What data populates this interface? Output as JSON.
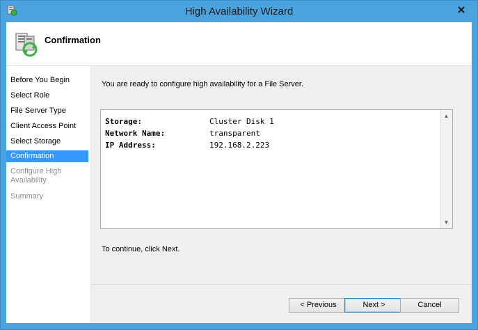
{
  "window": {
    "title": "High Availability Wizard"
  },
  "header": {
    "title": "Confirmation"
  },
  "nav": {
    "items": [
      {
        "label": "Before You Begin",
        "state": "done"
      },
      {
        "label": "Select Role",
        "state": "done"
      },
      {
        "label": "File Server Type",
        "state": "done"
      },
      {
        "label": "Client Access Point",
        "state": "done"
      },
      {
        "label": "Select Storage",
        "state": "done"
      },
      {
        "label": "Confirmation",
        "state": "selected"
      },
      {
        "label": "Configure High Availability",
        "state": "disabled"
      },
      {
        "label": "Summary",
        "state": "disabled"
      }
    ]
  },
  "main": {
    "intro": "You are ready to configure high availability for a File Server.",
    "summary": [
      {
        "label": "Storage:",
        "value": "Cluster Disk 1"
      },
      {
        "label": "Network Name:",
        "value": "transparent"
      },
      {
        "label": "IP Address:",
        "value": "192.168.2.223"
      }
    ],
    "continue_text": "To continue, click Next."
  },
  "buttons": {
    "previous": "< Previous",
    "next": "Next >",
    "cancel": "Cancel"
  },
  "colors": {
    "frame": "#4aa3df",
    "selection": "#3399ff",
    "content_bg": "#f0f0f0"
  }
}
